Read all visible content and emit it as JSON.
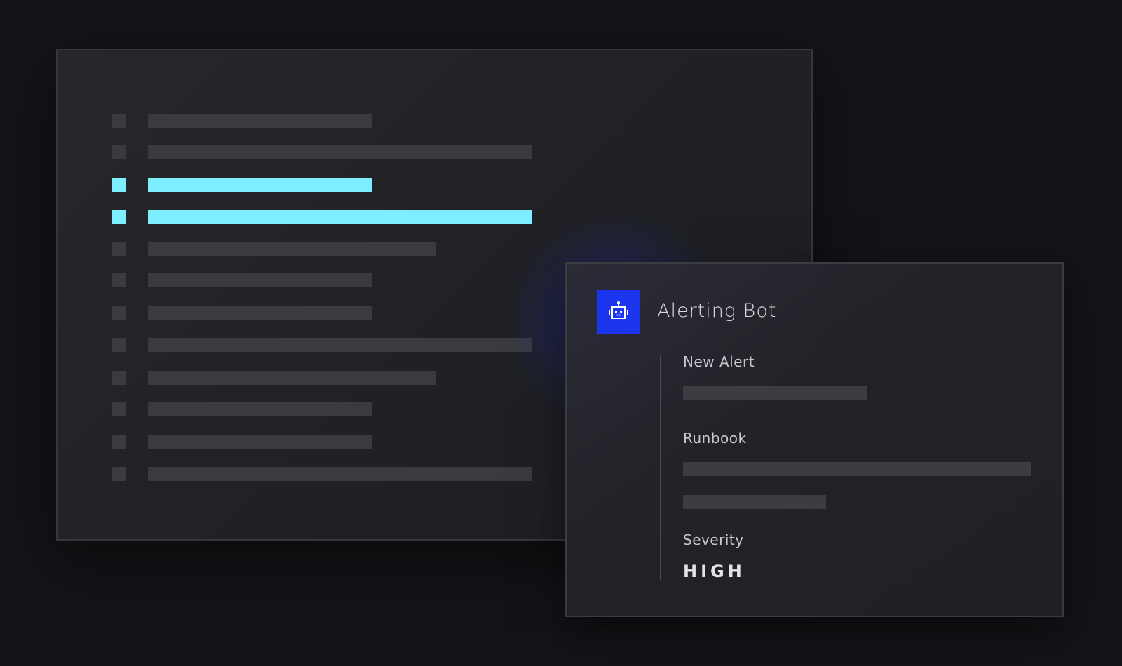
{
  "log_list": {
    "rows": [
      {
        "highlighted": false
      },
      {
        "highlighted": false
      },
      {
        "highlighted": true
      },
      {
        "highlighted": true
      },
      {
        "highlighted": false
      },
      {
        "highlighted": false
      },
      {
        "highlighted": false
      },
      {
        "highlighted": false
      },
      {
        "highlighted": false
      },
      {
        "highlighted": false
      },
      {
        "highlighted": false
      },
      {
        "highlighted": false
      }
    ]
  },
  "alert": {
    "bot_name": "Alerting Bot",
    "bot_icon": "robot-icon",
    "new_alert_label": "New Alert",
    "runbook_label": "Runbook",
    "severity_label": "Severity",
    "severity_value": "HIGH"
  },
  "colors": {
    "accent_highlight": "#7ceeff",
    "bot_avatar": "#1c36f0",
    "background": "#131417"
  }
}
